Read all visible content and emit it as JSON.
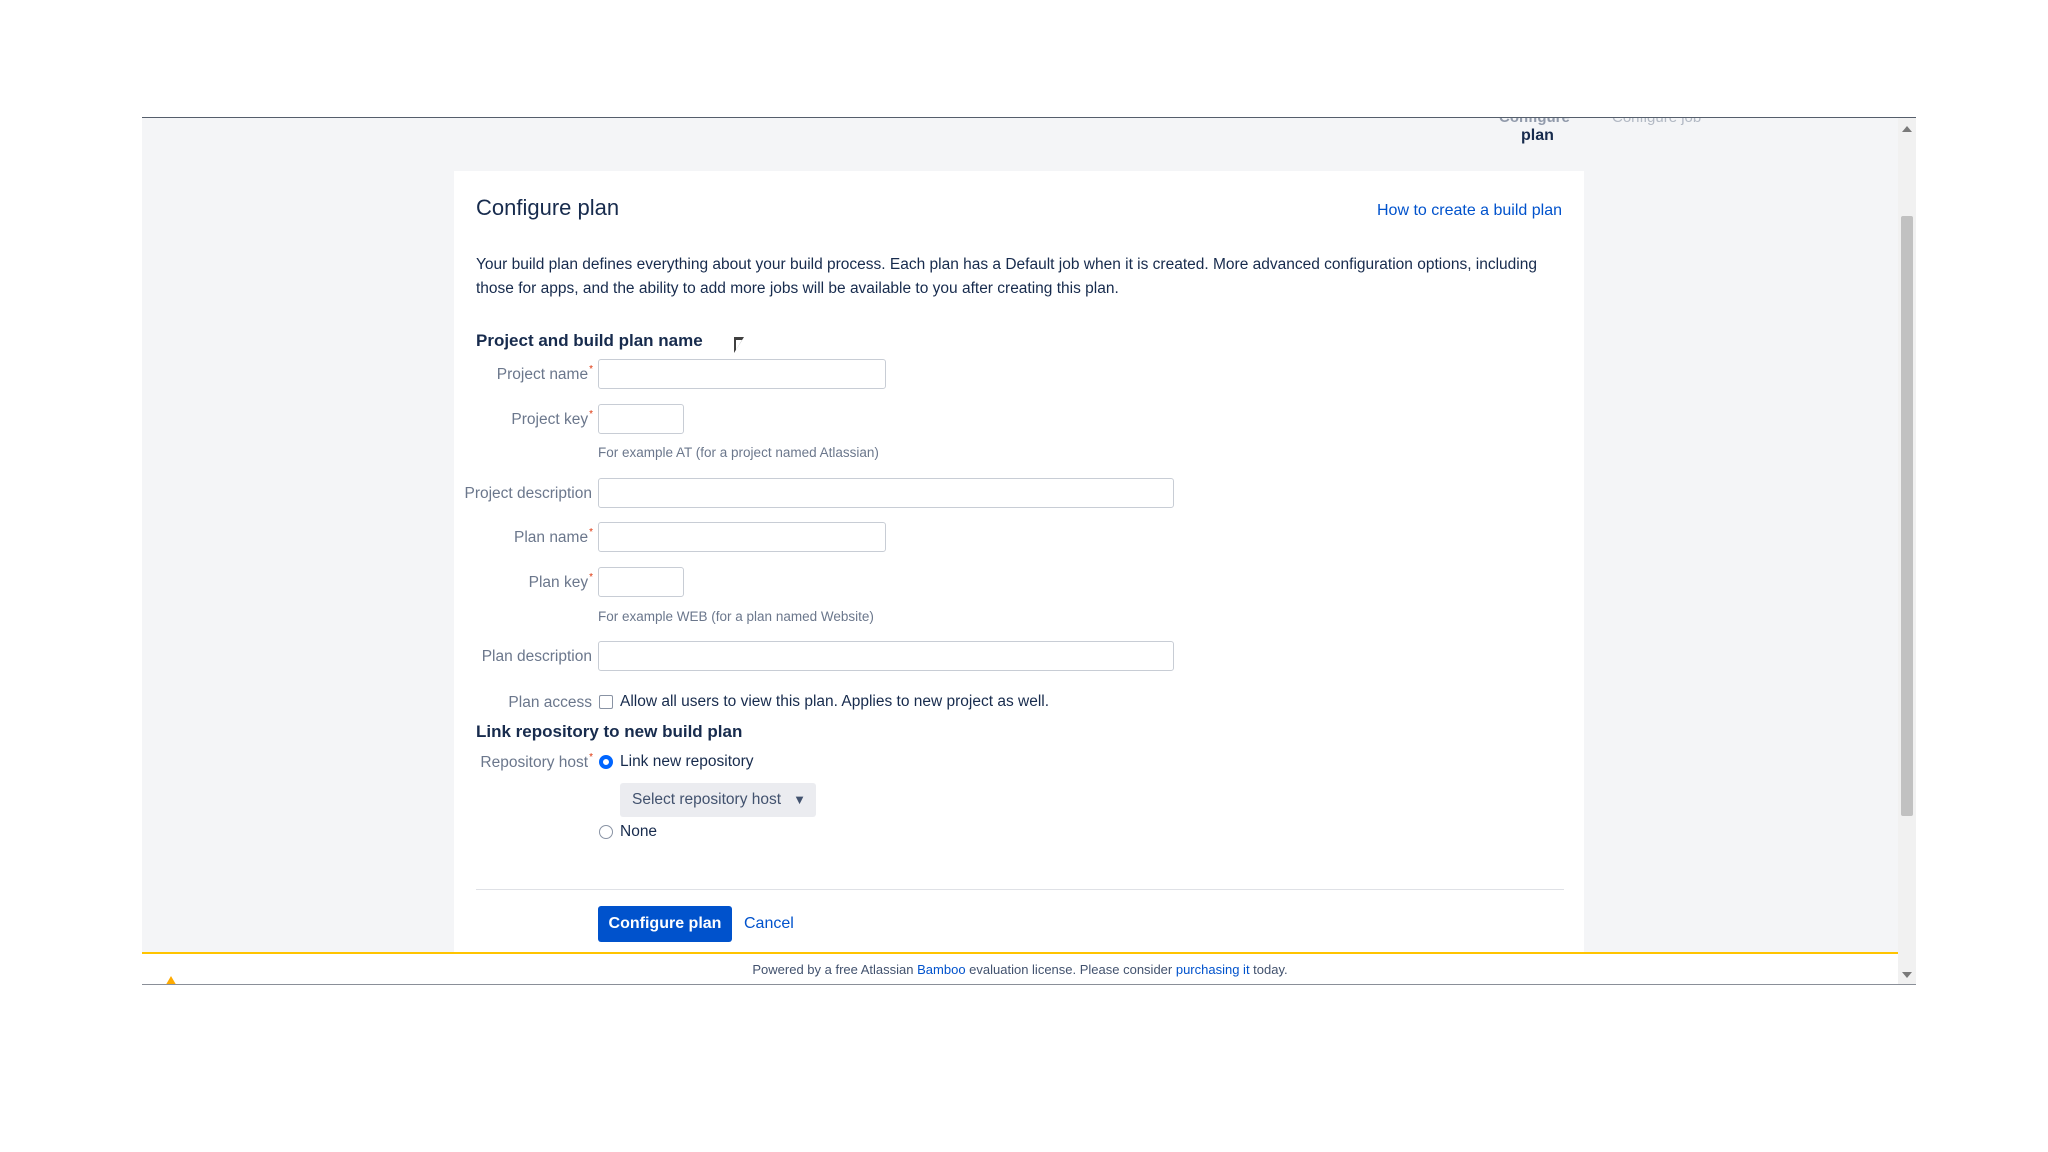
{
  "wizard": {
    "step_cut_1": "Configure",
    "step_cut_2": "Configure job",
    "step_current": "plan"
  },
  "panel": {
    "title": "Configure plan",
    "help_link": "How to create a build plan",
    "intro": "Your build plan defines everything about your build process. Each plan has a Default job when it is created. More advanced configuration options, including those for apps, and the ability to add more jobs will be available to you after creating this plan."
  },
  "section_project": {
    "title": "Project and build plan name",
    "project_name_label": "Project name",
    "project_key_label": "Project key",
    "project_key_hint": "For example AT (for a project named Atlassian)",
    "project_description_label": "Project description",
    "plan_name_label": "Plan name",
    "plan_key_label": "Plan key",
    "plan_key_hint": "For example WEB (for a plan named Website)",
    "plan_description_label": "Plan description",
    "plan_access_label": "Plan access",
    "plan_access_text": "Allow all users to view this plan. Applies to new project as well.",
    "required_mark": "*"
  },
  "section_repo": {
    "title": "Link repository to new build plan",
    "repository_host_label": "Repository host",
    "link_new_label": "Link new repository",
    "select_host_label": "Select repository host",
    "none_label": "None"
  },
  "actions": {
    "submit_label": "Configure plan",
    "cancel_label": "Cancel"
  },
  "footer": {
    "text_1": "Powered by a free Atlassian ",
    "link_bamboo": "Bamboo",
    "text_2": " evaluation license. Please consider ",
    "link_purchasing": "purchasing it",
    "text_3": " today."
  },
  "colors": {
    "primary": "#0052cc",
    "link": "#0052cc",
    "required": "#de350b",
    "footer_accent": "#ffc400"
  }
}
